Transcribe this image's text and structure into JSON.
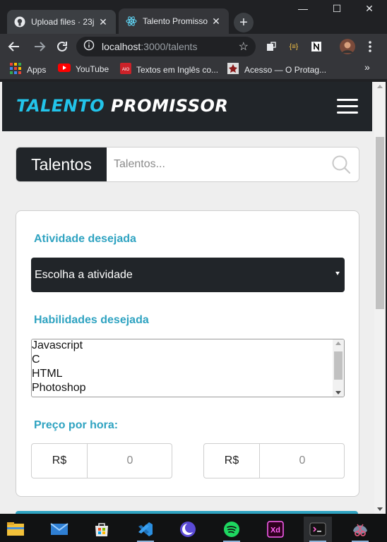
{
  "browser": {
    "tabs": [
      {
        "title": "Upload files · 23j",
        "icon": "github-icon",
        "active": false
      },
      {
        "title": "Talento Promisso",
        "icon": "react-icon",
        "active": true
      }
    ],
    "new_tab_symbol": "+",
    "window_controls": {
      "minimize": "—",
      "maximize": "☐",
      "close": "✕"
    },
    "url": {
      "host": "localhost",
      "path": ":3000/talents"
    },
    "bookmarks": [
      {
        "label": "Apps",
        "icon": "apps-grid-icon",
        "color": "#e94235"
      },
      {
        "label": "YouTube",
        "icon": "youtube-icon",
        "color": "#ff0000"
      },
      {
        "label": "Textos em Inglês co...",
        "icon": "aio-icon",
        "color": "#cc2229"
      },
      {
        "label": "Acesso — O Protag...",
        "icon": "protagonist-icon",
        "color": "#bbbbbb"
      }
    ],
    "bookmarks_overflow": "»"
  },
  "page": {
    "brand": {
      "part1": "TALENTO",
      "part2": "PROMISSOR"
    },
    "search": {
      "prefix": "Talentos",
      "placeholder": "Talentos..."
    },
    "filters": {
      "activity_label": "Atividade desejada",
      "activity_select": "Escolha a atividade",
      "skills_label": "Habilidades desejada",
      "skills": [
        "Javascript",
        "C",
        "HTML",
        "Photoshop"
      ],
      "price_label": "Preço por hora:",
      "price_min": {
        "currency": "R$",
        "placeholder": "0"
      },
      "price_max": {
        "currency": "R$",
        "placeholder": "0"
      }
    }
  },
  "colors": {
    "navbar": "#212529",
    "brand_accent": "#22c4ea",
    "label_accent": "#2fa3c1",
    "page_bg": "#eeeeee"
  },
  "taskbar": {
    "apps": [
      {
        "name": "file-explorer-icon"
      },
      {
        "name": "mail-icon"
      },
      {
        "name": "store-icon"
      },
      {
        "name": "vscode-icon"
      },
      {
        "name": "app-moon-icon"
      },
      {
        "name": "spotify-icon"
      },
      {
        "name": "xd-icon"
      },
      {
        "name": "terminal-icon"
      },
      {
        "name": "snipping-icon"
      }
    ]
  }
}
